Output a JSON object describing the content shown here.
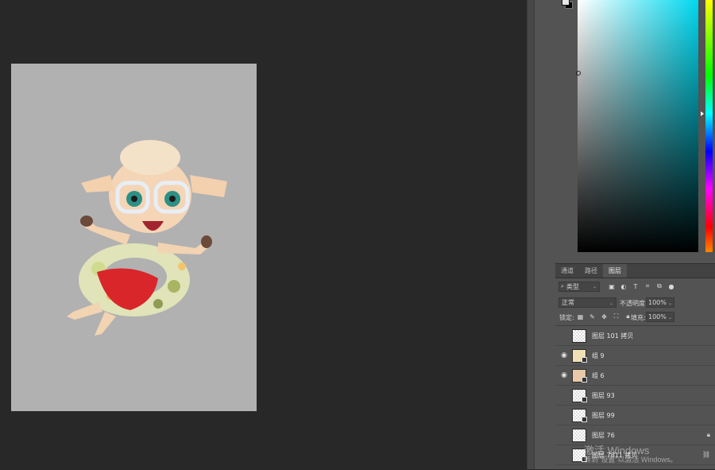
{
  "canvas": {
    "artwork": "cartoon lamb with glasses on swim ring"
  },
  "color_picker": {
    "hue_color": "#00d8ef",
    "foreground": "#e8e8e8",
    "background": "#000000"
  },
  "layers_panel": {
    "tabs": [
      {
        "label": "通道",
        "active": false
      },
      {
        "label": "路径",
        "active": false
      },
      {
        "label": "图层",
        "active": true
      }
    ],
    "filter": {
      "label": "类型",
      "icons": [
        "image-filter-icon",
        "adjustment-filter-icon",
        "type-filter-icon",
        "shape-filter-icon",
        "smart-object-filter-icon"
      ]
    },
    "blend_mode": "正常",
    "opacity_label": "不透明度:",
    "opacity": "100%",
    "lock_label": "锁定:",
    "fill_label": "填充:",
    "fill": "100%",
    "layers": [
      {
        "name": "图层 101 拷贝",
        "visible": false,
        "kind": "pixel",
        "locked": false
      },
      {
        "name": "组 9",
        "visible": true,
        "kind": "group",
        "locked": false
      },
      {
        "name": "组 6",
        "visible": true,
        "kind": "group",
        "locked": false
      },
      {
        "name": "图层 93",
        "visible": false,
        "kind": "smart",
        "locked": false
      },
      {
        "name": "图层 99",
        "visible": false,
        "kind": "smart",
        "locked": false
      },
      {
        "name": "图层 76",
        "visible": false,
        "kind": "pixel",
        "locked": true
      },
      {
        "name": "图层 7811 拷贝",
        "visible": false,
        "kind": "smart",
        "locked": false
      }
    ]
  },
  "watermark": {
    "line1": "激活 Windows",
    "line2": "转到\"设置\"以激活 Windows。"
  }
}
